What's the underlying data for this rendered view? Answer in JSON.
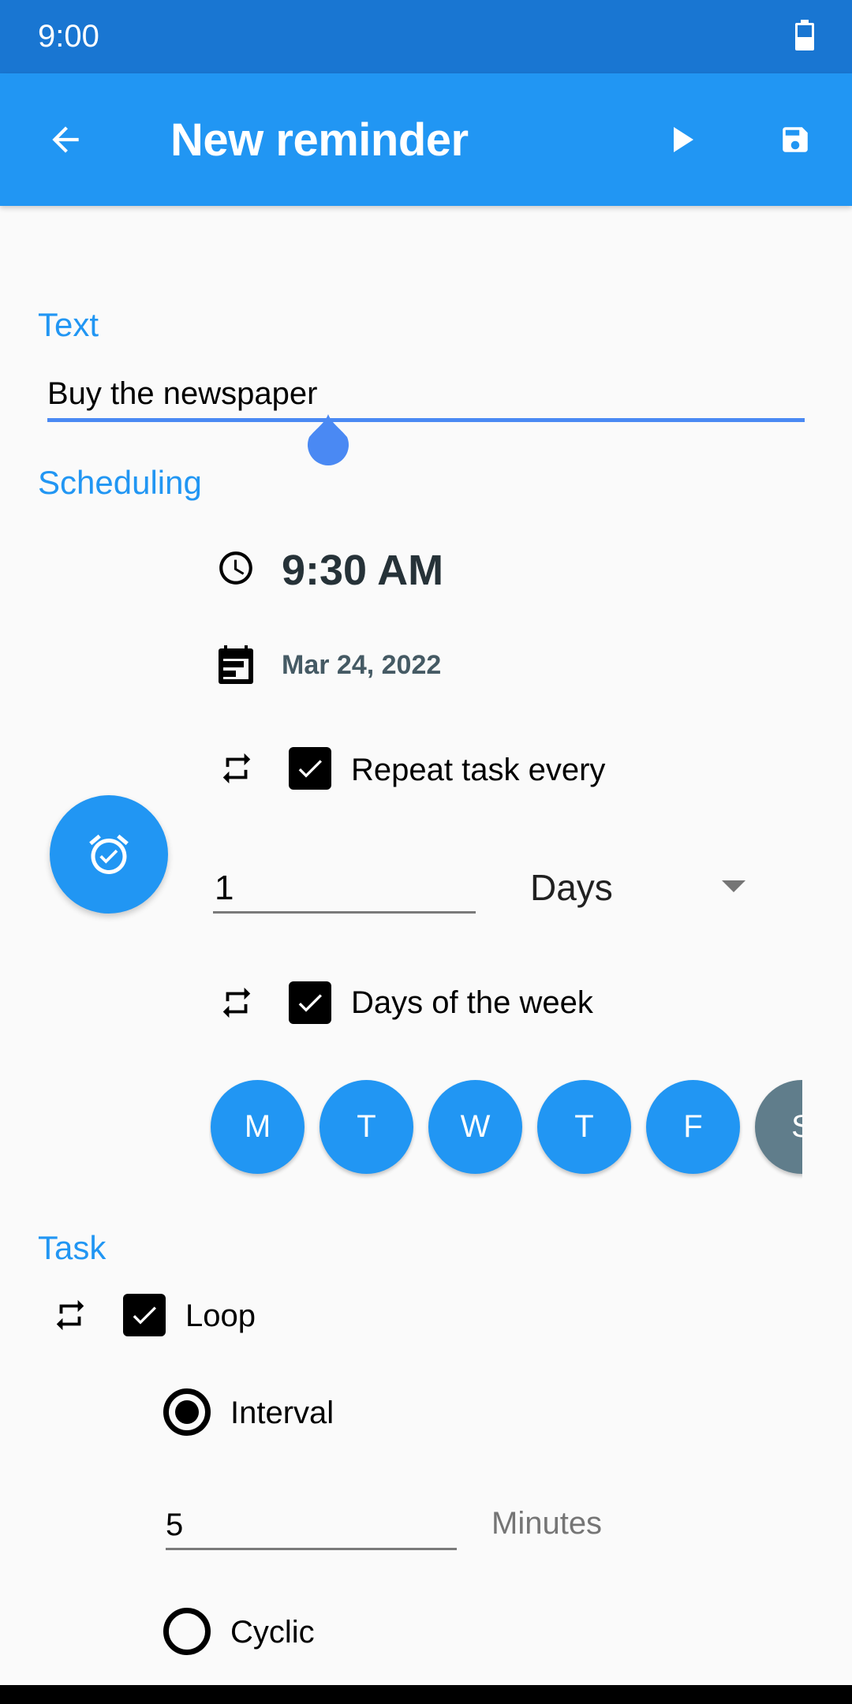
{
  "status_bar": {
    "time": "9:00",
    "icons": [
      "battery-icon"
    ]
  },
  "app_bar": {
    "title": "New reminder",
    "back_icon": "arrow-back-icon",
    "actions": [
      {
        "name": "play",
        "icon": "play-icon"
      },
      {
        "name": "save",
        "icon": "save-icon"
      }
    ]
  },
  "text_section": {
    "label": "Text",
    "input_value": "Buy the newspaper"
  },
  "scheduling": {
    "label": "Scheduling",
    "time": "9:30 AM",
    "date": "Mar 24, 2022",
    "repeat_every": {
      "label": "Repeat task every",
      "checked": true,
      "value": "1",
      "unit": "Days"
    },
    "days_of_week": {
      "label": "Days of the week",
      "checked": true,
      "days": [
        {
          "label": "M",
          "selected": true
        },
        {
          "label": "T",
          "selected": true
        },
        {
          "label": "W",
          "selected": true
        },
        {
          "label": "T",
          "selected": true
        },
        {
          "label": "F",
          "selected": true
        },
        {
          "label": "S",
          "selected": false
        }
      ]
    },
    "fab_icon": "alarm-check-icon"
  },
  "task": {
    "label": "Task",
    "loop": {
      "label": "Loop",
      "checked": true
    },
    "interval": {
      "label": "Interval",
      "selected": true,
      "value": "5",
      "unit": "Minutes"
    },
    "cyclic": {
      "label": "Cyclic",
      "selected": false
    }
  },
  "colors": {
    "status_bar": "#1976D2",
    "primary": "#2196F3",
    "day_unselected": "#607D8B",
    "background": "#FAFAFA"
  }
}
